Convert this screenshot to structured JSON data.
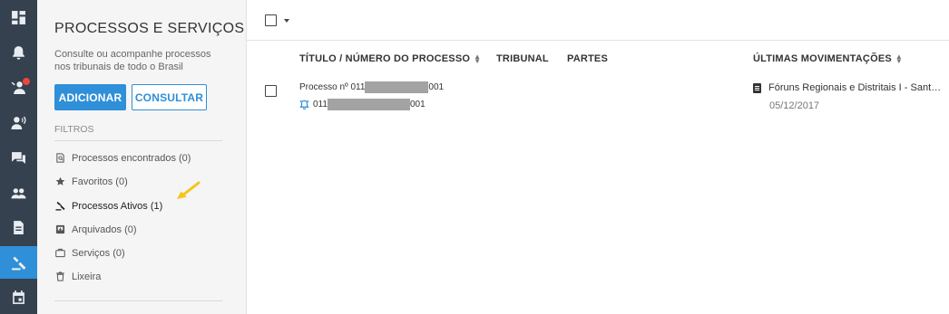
{
  "sidebar": {
    "title": "PROCESSOS E SERVIÇOS",
    "description": "Consulte ou acompanhe processos nos tribunais de todo o Brasil",
    "add_label": "ADICIONAR",
    "consult_label": "CONSULTAR",
    "filters_label": "FILTROS",
    "items": [
      {
        "label": "Processos encontrados (0)",
        "icon": "search-doc-icon"
      },
      {
        "label": "Favoritos (0)",
        "icon": "star-icon"
      },
      {
        "label": "Processos Ativos (1)",
        "icon": "gavel-icon"
      },
      {
        "label": "Arquivados (0)",
        "icon": "archive-icon"
      },
      {
        "label": "Serviços (0)",
        "icon": "briefcase-icon"
      },
      {
        "label": "Lixeira",
        "icon": "trash-icon"
      }
    ]
  },
  "rail": {
    "items": [
      "dashboard-icon",
      "bell-icon",
      "contacts-icon",
      "user-voice-icon",
      "chat-icon",
      "people-icon",
      "document-icon",
      "gavel-icon",
      "calendar-icon"
    ],
    "active_index": 7,
    "badge_index": 2
  },
  "table": {
    "headers": {
      "title": "TÍTULO / NÚMERO DO PROCESSO",
      "court": "TRIBUNAL",
      "parties": "PARTES",
      "movements": "ÚLTIMAS MOVIMENTAÇÕES"
    },
    "rows": [
      {
        "title_prefix": "Processo nº 011",
        "title_suffix": "001",
        "number_prefix": "011",
        "number_suffix": "001",
        "movement": "Fóruns Regionais e Distritais I - Sant…",
        "movement_date": "05/12/2017"
      }
    ]
  },
  "colors": {
    "rail_bg": "#35414f",
    "accent": "#2f8fd8",
    "badge": "#e8483b",
    "annotation_arrow": "#f5c518"
  }
}
